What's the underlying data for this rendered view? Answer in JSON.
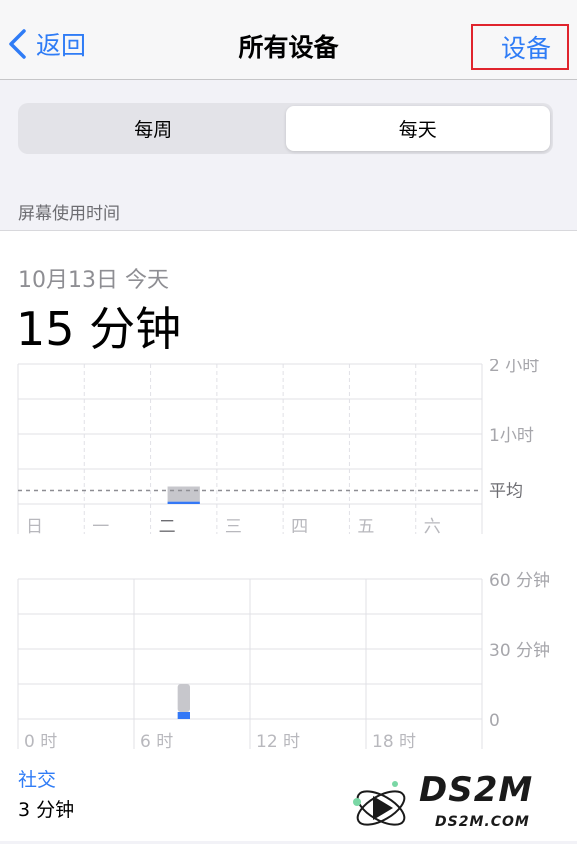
{
  "nav": {
    "back_label": "返回",
    "title": "所有设备",
    "devices_label": "设备"
  },
  "segments": {
    "weekly": "每周",
    "daily": "每天",
    "selected": "daily"
  },
  "section": {
    "title": "屏幕使用时间"
  },
  "summary": {
    "date": "10月13日 今天",
    "total": "15 分钟"
  },
  "chart_data": [
    {
      "type": "bar",
      "categories": [
        "日",
        "一",
        "二",
        "三",
        "四",
        "五",
        "六"
      ],
      "y_ticks": [
        "2 小时",
        "1小时"
      ],
      "average_label": "平均",
      "ylim_minutes": [
        0,
        120
      ],
      "average_minutes": 15,
      "series": [
        {
          "values": [
            0,
            0,
            2,
            0,
            0,
            0,
            0
          ],
          "color": "#3478f6"
        },
        {
          "values": [
            0,
            0,
            13,
            0,
            0,
            0,
            0
          ],
          "color": "#c7c7cc"
        }
      ],
      "highlighted_category": "二"
    },
    {
      "type": "bar",
      "x_ticks": [
        "0 时",
        "6 时",
        "12 时",
        "18 时"
      ],
      "y_ticks": [
        "60 分钟",
        "30 分钟",
        "0"
      ],
      "ylim_minutes": [
        0,
        60
      ],
      "hours": 24,
      "series": [
        {
          "values": [
            0,
            0,
            0,
            0,
            0,
            0,
            0,
            0,
            3,
            0,
            0,
            0,
            0,
            0,
            0,
            0,
            0,
            0,
            0,
            0,
            0,
            0,
            0,
            0
          ],
          "color": "#3478f6"
        },
        {
          "values": [
            0,
            0,
            0,
            0,
            0,
            0,
            0,
            0,
            12,
            0,
            0,
            0,
            0,
            0,
            0,
            0,
            0,
            0,
            0,
            0,
            0,
            0,
            0,
            0
          ],
          "color": "#c7c7cc"
        }
      ]
    }
  ],
  "category": {
    "name": "社交",
    "value": "3 分钟"
  },
  "watermark": {
    "text": "DS2M",
    "sub": "DS2M.COM"
  },
  "colors": {
    "accent": "#2f7cf6",
    "highlight_border": "#e0242d"
  }
}
